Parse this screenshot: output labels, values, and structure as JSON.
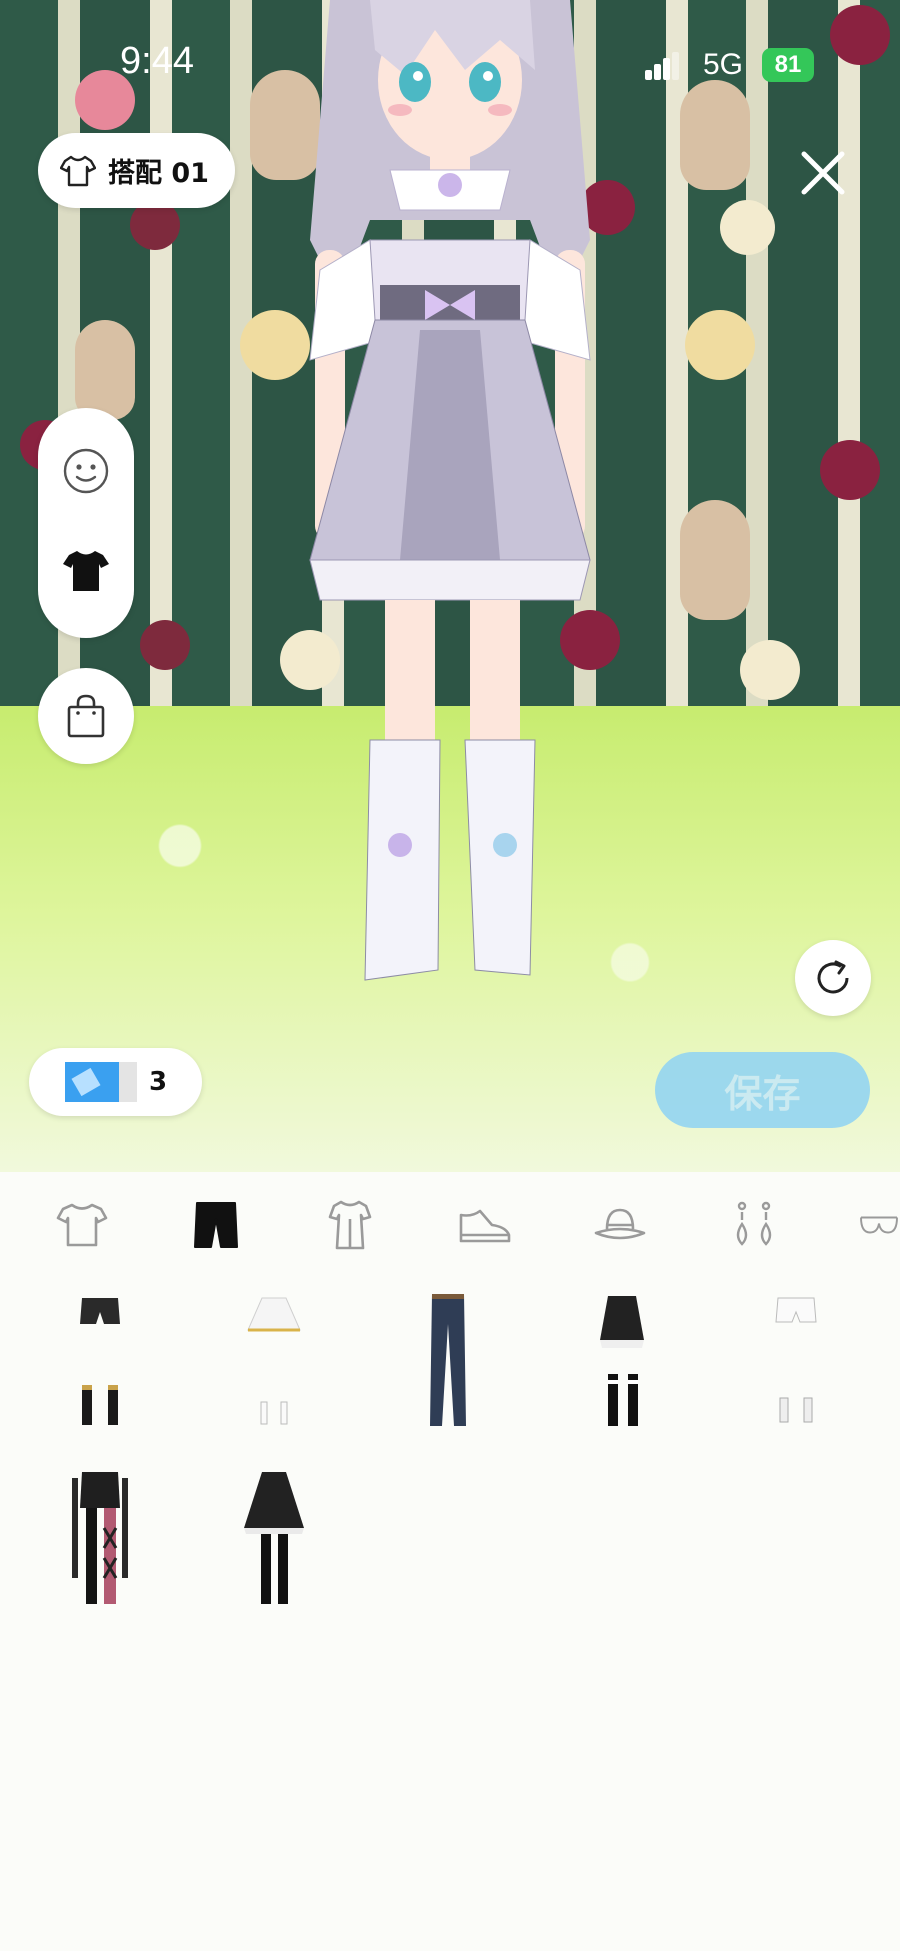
{
  "status_bar": {
    "time": "9:44",
    "network": "5G",
    "battery": "81"
  },
  "outfit": {
    "label": "搭配 01"
  },
  "ticket": {
    "count": "3"
  },
  "save_button": {
    "label": "保存"
  },
  "side_tools": [
    {
      "name": "face-icon"
    },
    {
      "name": "tshirt-filled-icon"
    },
    {
      "name": "shopping-bag-icon"
    }
  ],
  "categories": [
    {
      "name": "tshirt-category-icon",
      "selected": false
    },
    {
      "name": "pants-category-icon",
      "selected": true
    },
    {
      "name": "dress-category-icon",
      "selected": false
    },
    {
      "name": "shoe-category-icon",
      "selected": false
    },
    {
      "name": "hat-category-icon",
      "selected": false
    },
    {
      "name": "earring-category-icon",
      "selected": false
    },
    {
      "name": "bra-category-icon",
      "selected": false
    }
  ],
  "items": [
    {
      "name": "black-shorts-item"
    },
    {
      "name": "white-pleated-skirt-item"
    },
    {
      "name": "denim-jeans-item"
    },
    {
      "name": "black-ruffle-shorts-item"
    },
    {
      "name": "white-shorts-item"
    },
    {
      "name": "black-lace-pants-item"
    },
    {
      "name": "black-flared-skirt-item"
    }
  ],
  "colors": {
    "wall_green": "#2f5a48",
    "floor_green": "#c7ec6f",
    "save_blue": "#8fd3f4",
    "battery_green": "#34c759"
  }
}
